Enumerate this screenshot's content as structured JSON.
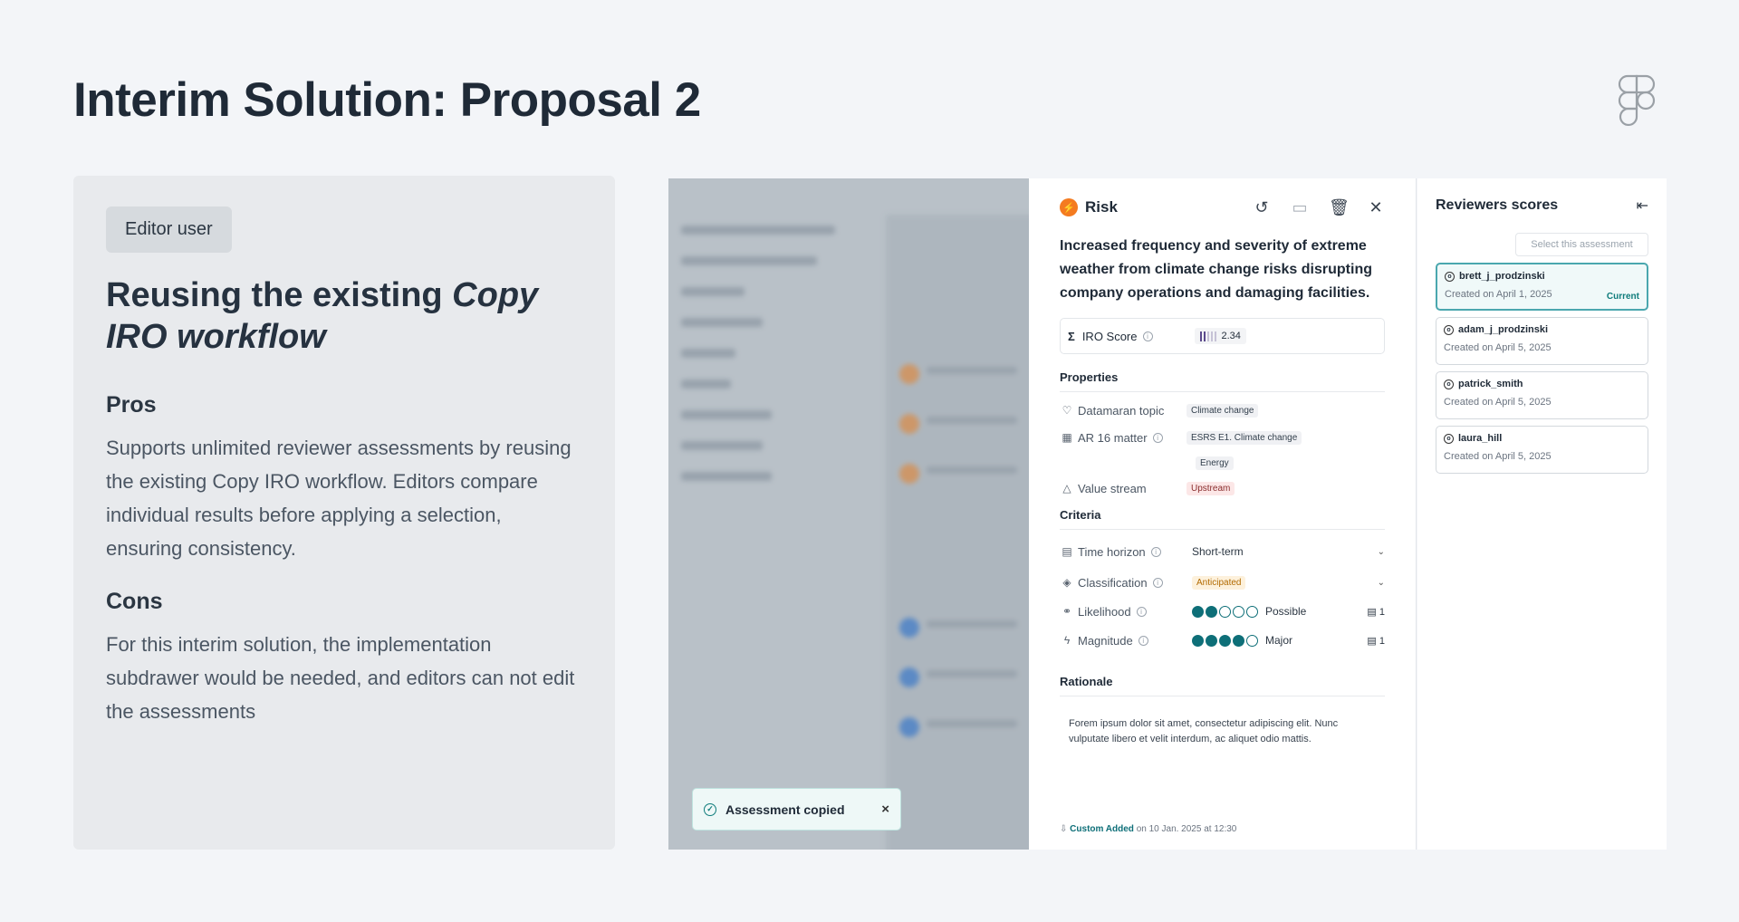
{
  "slide": {
    "title": "Interim Solution: Proposal 2"
  },
  "left": {
    "badge": "Editor user",
    "heading_plain": "Reusing the existing ",
    "heading_em": "Copy IRO workflow",
    "pros_title": "Pros",
    "pros_body": "Supports unlimited reviewer assessments by reusing the existing  Copy IRO workflow. Editors compare individual results before applying a selection, ensuring consistency.",
    "cons_title": "Cons",
    "cons_body": "For this interim solution, the implementation subdrawer would be needed, and editors can not edit the assessments"
  },
  "toast": {
    "text": "Assessment copied",
    "close": "×"
  },
  "drawer": {
    "type_label": "Risk",
    "actions": {
      "undo": "↺",
      "present": "▭",
      "delete": "🗑",
      "close": "✕"
    },
    "description": "Increased frequency and severity of extreme weather from climate change risks disrupting company operations and damaging facilities.",
    "iro": {
      "sigma": "Σ",
      "label": "IRO Score",
      "value": "2.34",
      "filled_bars": 2,
      "total_bars": 5
    },
    "properties_title": "Properties",
    "properties": {
      "topic_label": "Datamaran topic",
      "topic_value": "Climate change",
      "ar16_label": "AR 16 matter",
      "ar16_values": [
        "ESRS E1. Climate change",
        "Energy"
      ],
      "value_stream_label": "Value stream",
      "value_stream_value": "Upstream"
    },
    "criteria_title": "Criteria",
    "criteria": {
      "time_label": "Time horizon",
      "time_value": "Short-term",
      "class_label": "Classification",
      "class_value": "Anticipated",
      "likelihood_label": "Likelihood",
      "likelihood_value": "Possible",
      "likelihood_level": 2,
      "likelihood_comments": "1",
      "magnitude_label": "Magnitude",
      "magnitude_value": "Major",
      "magnitude_level": 4,
      "magnitude_comments": "1"
    },
    "rationale_title": "Rationale",
    "rationale_text": "Forem ipsum dolor sit amet, consectetur adipiscing elit. Nunc vulputate libero et velit interdum, ac aliquet odio mattis.",
    "added_by": "Custom Added",
    "added_on": "on 10 Jan. 2025 at 12:30"
  },
  "reviewers": {
    "title": "Reviewers scores",
    "select_label": "Select this assessment",
    "current_label": "Current",
    "items": [
      {
        "name": "brett_j_prodzinski",
        "date": "Created on April 1, 2025"
      },
      {
        "name": "adam_j_prodzinski",
        "date": "Created on April 5, 2025"
      },
      {
        "name": "patrick_smith",
        "date": "Created on April 5, 2025"
      },
      {
        "name": "laura_hill",
        "date": "Created on April 5, 2025"
      }
    ]
  },
  "colors": {
    "accent": "#0e6f78",
    "risk": "#f47b20",
    "background": "#f3f5f8"
  }
}
